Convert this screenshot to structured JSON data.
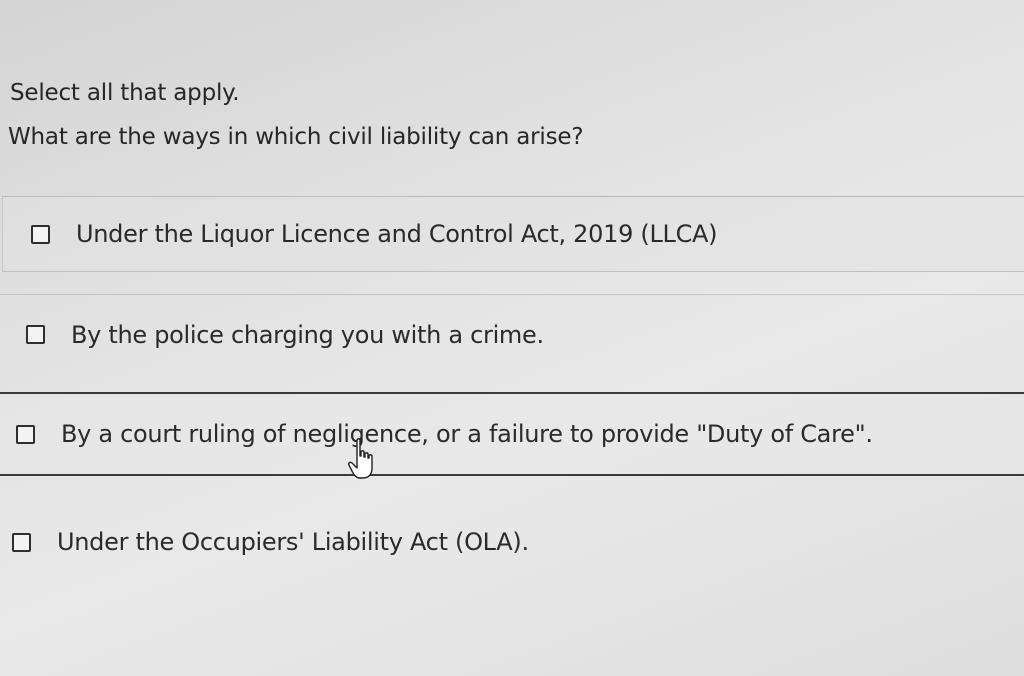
{
  "quiz": {
    "instruction": "Select all that apply.",
    "question": "What are the ways in which civil liability can arise?",
    "options": [
      {
        "label": "Under the Liquor Licence and Control Act, 2019 (LLCA)",
        "checked": false
      },
      {
        "label": "By the police charging you with a crime.",
        "checked": false
      },
      {
        "label": "By a court ruling of negligence, or a failure to provide \"Duty of Care\".",
        "checked": false
      },
      {
        "label": "Under the Occupiers' Liability Act (OLA).",
        "checked": false
      }
    ]
  },
  "cursor": {
    "icon": "hand-pointer-icon"
  }
}
